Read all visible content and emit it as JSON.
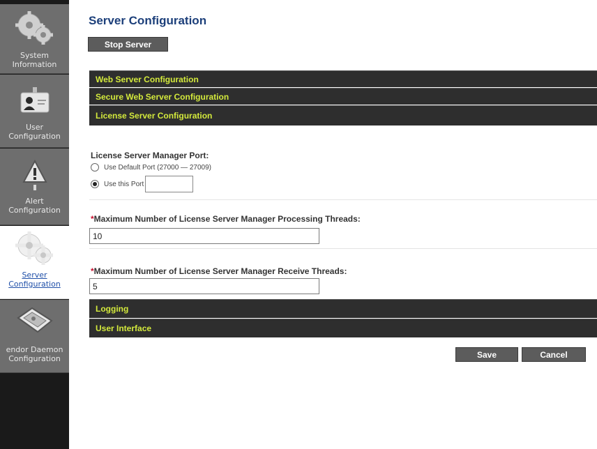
{
  "sidebar": {
    "items": [
      {
        "line1": "System",
        "line2": "Information"
      },
      {
        "line1": "User",
        "line2": "Configuration"
      },
      {
        "line1": "Alert",
        "line2": "Configuration"
      },
      {
        "line1": "Server",
        "line2": "Configuration"
      },
      {
        "line1": "endor Daemon",
        "line2": "Configuration"
      }
    ]
  },
  "main": {
    "title": "Server Configuration",
    "stop_button": "Stop Server",
    "sections": {
      "web": "Web Server Configuration",
      "secure": "Secure Web Server Configuration",
      "license": "License Server Configuration",
      "logging": "Logging",
      "ui": "User Interface"
    },
    "port": {
      "label": "License Server Manager Port:",
      "option_default": "Use Default Port (27000 — 27009)",
      "option_custom": "Use this Port",
      "custom_value": ""
    },
    "threads": {
      "required_mark": "*",
      "label": "Maximum Number of License Server Manager Processing Threads:",
      "value": "10"
    },
    "receive": {
      "required_mark": "*",
      "label": "Maximum Number of License Server Manager Receive Threads:",
      "value": "5"
    },
    "save_button": "Save",
    "cancel_button": "Cancel"
  }
}
